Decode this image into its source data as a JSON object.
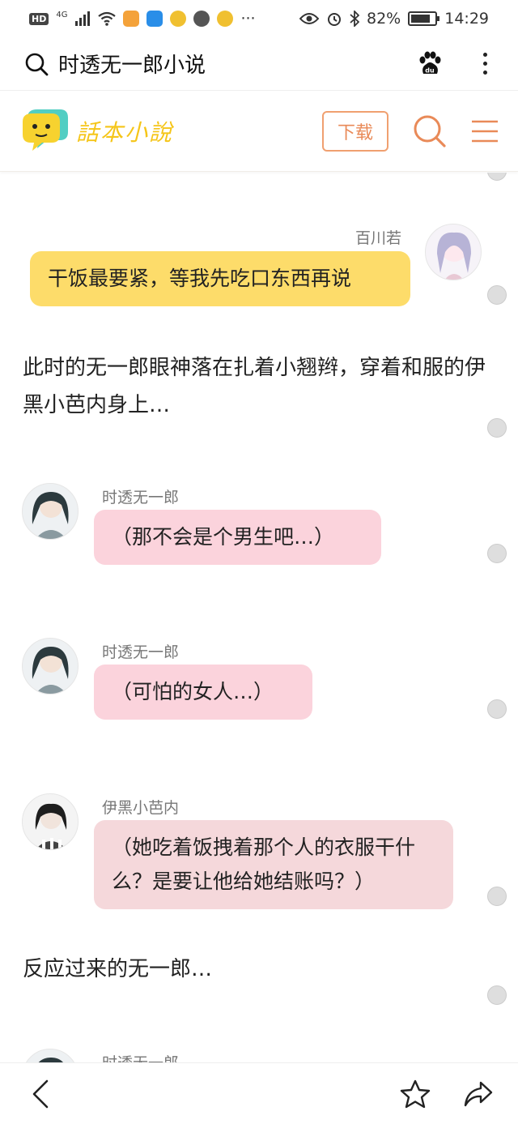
{
  "status_bar": {
    "hd": "HD",
    "network": "4G",
    "battery_percent": "82%",
    "battery_level": 0.82,
    "time": "14:29",
    "more": "···"
  },
  "browser": {
    "title": "时透无一郎小说"
  },
  "site": {
    "logo_text": "話本小說",
    "download_label": "下载",
    "accent_color": "#e98a58",
    "logo_color": "#f5c518"
  },
  "messages": [
    {
      "type": "chat",
      "side": "right",
      "speaker": "百川若",
      "text": "干饭最要紧，等我先吃口东西再说",
      "color": "#fddc6a"
    },
    {
      "type": "narration",
      "text": "此时的无一郎眼神落在扎着小翘辫，穿着和服的伊黑小芭内身上…"
    },
    {
      "type": "chat",
      "side": "left",
      "speaker": "时透无一郎",
      "text": "（那不会是个男生吧…）",
      "color": "#fbd3dc"
    },
    {
      "type": "chat",
      "side": "left",
      "speaker": "时透无一郎",
      "text": "（可怕的女人…）",
      "color": "#fbd3dc"
    },
    {
      "type": "chat",
      "side": "left",
      "speaker": "伊黑小芭内",
      "text": "（她吃着饭拽着那个人的衣服干什么？是要让他给她结账吗？）",
      "color": "#f5d8db"
    },
    {
      "type": "narration",
      "text": "反应过来的无一郎…"
    },
    {
      "type": "chat",
      "side": "left",
      "speaker": "时透无一郎",
      "text": "",
      "color": "#fbd3dc"
    }
  ]
}
